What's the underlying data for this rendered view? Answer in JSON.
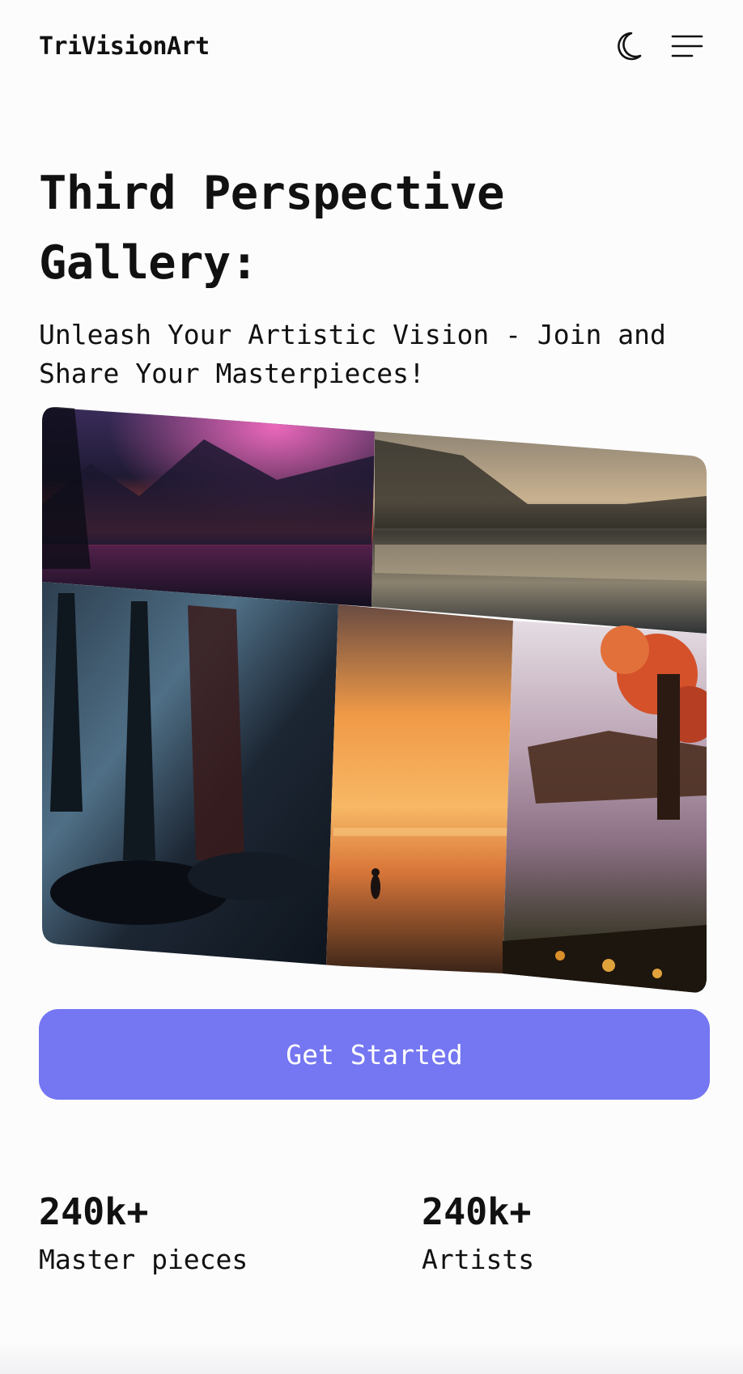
{
  "header": {
    "brand": "TriVisionArt",
    "theme_toggle_icon": "moon-icon",
    "menu_icon": "hamburger-menu-icon"
  },
  "hero": {
    "title": "Third Perspective Gallery:",
    "subtitle": "Unleash Your Artistic Vision - Join and Share Your Masterpieces!"
  },
  "gallery": {
    "artworks": [
      "neon-mountain-lake-artwork",
      "misty-reflection-lake-artwork",
      "dark-forest-river-artwork",
      "golden-sunset-lake-artwork",
      "autumn-tree-lake-artwork"
    ]
  },
  "cta": {
    "label": "Get Started"
  },
  "stats": [
    {
      "value": "240k+",
      "label": "Master pieces"
    },
    {
      "value": "240k+",
      "label": "Artists"
    }
  ],
  "colors": {
    "accent": "#7576f1",
    "text": "#111111",
    "background": "#fcfcfd"
  }
}
